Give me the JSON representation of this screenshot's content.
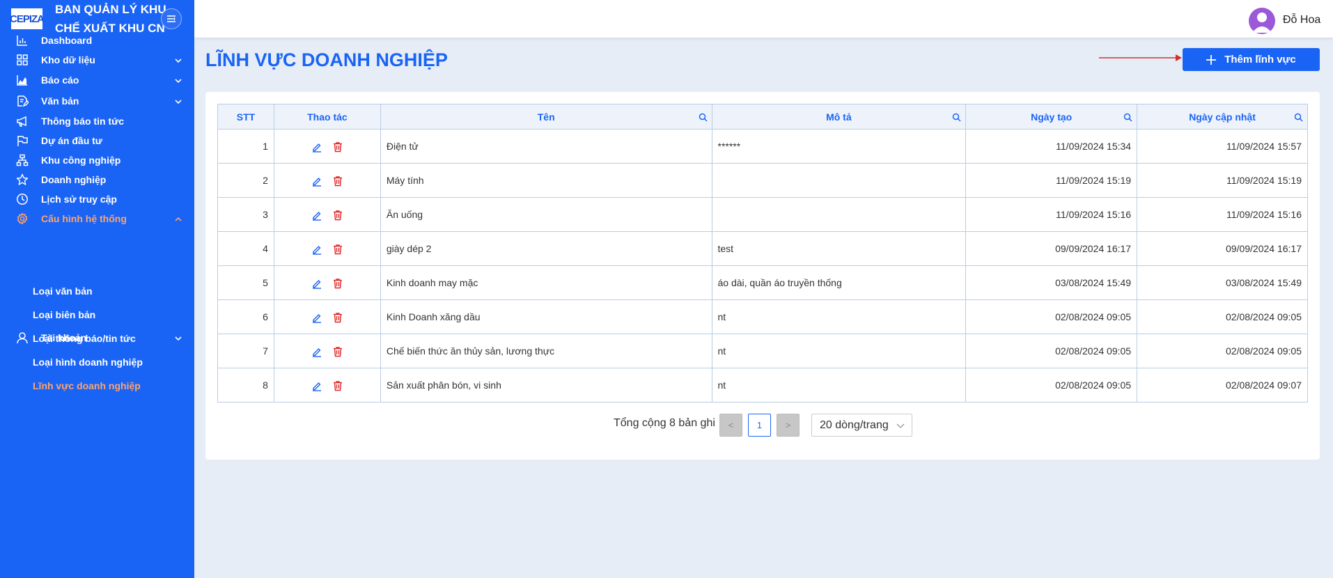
{
  "brand": {
    "logo_text": "CEPIZA",
    "line1": "BAN QUẢN LÝ KHU",
    "line2": "CHẾ XUẤT KHU CN"
  },
  "nav": {
    "items": [
      {
        "label": "Dashboard",
        "icon": "bar-chart-icon",
        "has_chevron": false
      },
      {
        "label": "Kho dữ liệu",
        "icon": "grid-icon",
        "has_chevron": true
      },
      {
        "label": "Báo cáo",
        "icon": "area-chart-icon",
        "has_chevron": true
      },
      {
        "label": "Văn bản",
        "icon": "document-edit-icon",
        "has_chevron": true
      },
      {
        "label": "Thông báo tin tức",
        "icon": "megaphone-icon",
        "has_chevron": false
      },
      {
        "label": "Dự án đầu tư",
        "icon": "flag-icon",
        "has_chevron": false
      },
      {
        "label": "Khu công nghiệp",
        "icon": "org-chart-icon",
        "has_chevron": false
      },
      {
        "label": "Doanh nghiệp",
        "icon": "star-icon",
        "has_chevron": false
      },
      {
        "label": "Lịch sử truy cập",
        "icon": "clock-icon",
        "has_chevron": false
      },
      {
        "label": "Cấu hình hệ thống",
        "icon": "gear-icon",
        "has_chevron": true,
        "active": true,
        "expanded": true
      },
      {
        "label": "Tài khoản",
        "icon": "user-icon",
        "has_chevron": true
      }
    ],
    "sub_items": [
      {
        "label": "Loại văn bản"
      },
      {
        "label": "Loại biên bản"
      },
      {
        "label": "Loại thông báo/tin tức"
      },
      {
        "label": "Loại hình doanh nghiệp"
      },
      {
        "label": "Lĩnh vực doanh nghiệp",
        "active": true
      }
    ]
  },
  "header": {
    "username": "Đỗ Hoa"
  },
  "page": {
    "title": "LĨNH VỰC DOANH NGHIỆP",
    "add_button": "Thêm lĩnh vực"
  },
  "table": {
    "columns": [
      "STT",
      "Thao tác",
      "Tên",
      "Mô tả",
      "Ngày tạo",
      "Ngày cập nhật"
    ],
    "rows": [
      {
        "stt": "1",
        "ten": "Điện tử",
        "mo_ta": "******",
        "ngay_tao": "11/09/2024 15:34",
        "ngay_cap_nhat": "11/09/2024 15:57"
      },
      {
        "stt": "2",
        "ten": "Máy tính",
        "mo_ta": "",
        "ngay_tao": "11/09/2024 15:19",
        "ngay_cap_nhat": "11/09/2024 15:19"
      },
      {
        "stt": "3",
        "ten": "Ăn uống",
        "mo_ta": "",
        "ngay_tao": "11/09/2024 15:16",
        "ngay_cap_nhat": "11/09/2024 15:16"
      },
      {
        "stt": "4",
        "ten": "giày dép 2",
        "mo_ta": "test",
        "ngay_tao": "09/09/2024 16:17",
        "ngay_cap_nhat": "09/09/2024 16:17"
      },
      {
        "stt": "5",
        "ten": "Kinh doanh may mặc",
        "mo_ta": "áo dài, quần áo truyền thống",
        "ngay_tao": "03/08/2024 15:49",
        "ngay_cap_nhat": "03/08/2024 15:49"
      },
      {
        "stt": "6",
        "ten": "Kinh Doanh xăng dầu",
        "mo_ta": "nt",
        "ngay_tao": "02/08/2024 09:05",
        "ngay_cap_nhat": "02/08/2024 09:05"
      },
      {
        "stt": "7",
        "ten": "Chế biến thức ăn thủy sản, lương thực",
        "mo_ta": "nt",
        "ngay_tao": "02/08/2024 09:05",
        "ngay_cap_nhat": "02/08/2024 09:05"
      },
      {
        "stt": "8",
        "ten": "Sản xuất phân bón, vi sinh",
        "mo_ta": "nt",
        "ngay_tao": "02/08/2024 09:05",
        "ngay_cap_nhat": "02/08/2024 09:07"
      }
    ]
  },
  "pagination": {
    "total": "Tổng cộng 8 bản ghi",
    "current_page": "1",
    "prev": "<",
    "next": ">",
    "page_size": "20 dòng/trang"
  },
  "colors": {
    "primary": "#1a64f5",
    "active_menu": "#ffa36b",
    "delete": "#e02424",
    "background": "#e6edf6"
  }
}
